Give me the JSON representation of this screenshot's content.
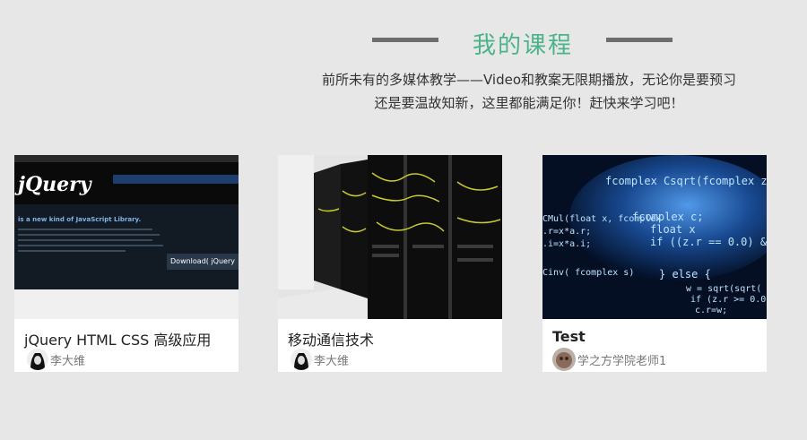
{
  "section": {
    "title": "我的课程",
    "subtitle_line1": "前所未有的多媒体教学——Video和教案无限期播放，无论你是要预习",
    "subtitle_line2": "还是要温故知新，这里都能满足你！赶快来学习吧！"
  },
  "courses": [
    {
      "title": "jQuery HTML CSS 高级应用",
      "author": "李大维",
      "thumbnail": "jquery-website-screenshot"
    },
    {
      "title": "移动通信技术",
      "author": "李大维",
      "thumbnail": "server-room-photo"
    },
    {
      "title": "Test",
      "author": "学之方学院老师1",
      "thumbnail": "code-over-earth-image"
    }
  ],
  "colors": {
    "accent": "#4bb38a",
    "background": "#e7e7e7",
    "divider": "#6e6e6e"
  }
}
